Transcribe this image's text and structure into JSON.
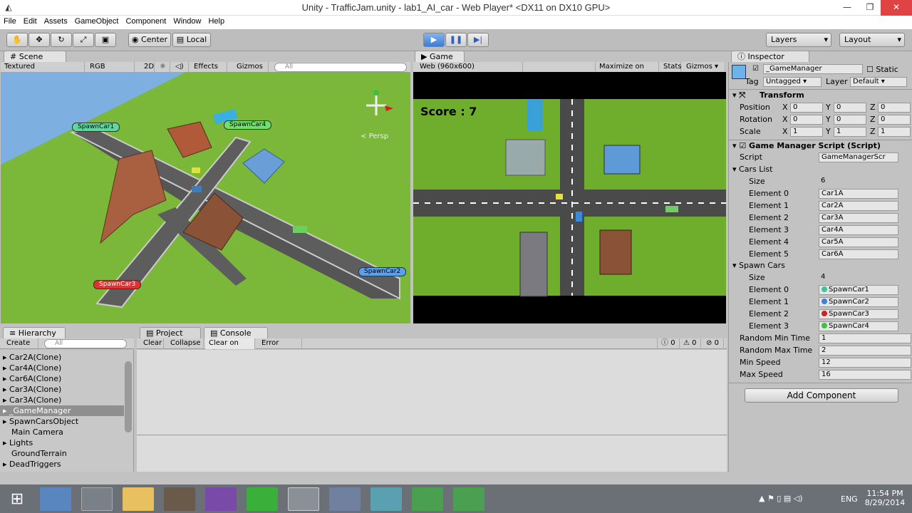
{
  "window": {
    "title": "Unity - TrafficJam.unity - lab1_AI_car - Web Player* <DX11 on DX10 GPU>"
  },
  "menu": [
    "File",
    "Edit",
    "Assets",
    "GameObject",
    "Component",
    "Window",
    "Help"
  ],
  "toolbar": {
    "center": "Center",
    "local": "Local",
    "layers": "Layers",
    "layout": "Layout"
  },
  "scene": {
    "tab": "Scene",
    "textured": "Textured",
    "rgb": "RGB",
    "mode2d": "2D",
    "effects": "Effects",
    "gizmos": "Gizmos",
    "search": "All",
    "persp": "Persp",
    "spawns": [
      {
        "label": "SpawnCar1",
        "color": "#5fd8a0"
      },
      {
        "label": "SpawnCar4",
        "color": "#6fe06a"
      },
      {
        "label": "SpawnCar2",
        "color": "#5aa0f0"
      },
      {
        "label": "SpawnCar3",
        "color": "#e33030"
      }
    ]
  },
  "game": {
    "tab": "Game",
    "resolution": "Web (960x600)",
    "maximize": "Maximize on Play",
    "stats": "Stats",
    "gizmos": "Gizmos",
    "score": "Score : 7"
  },
  "hierarchy": {
    "tab": "Hierarchy",
    "create": "Create",
    "search": "All",
    "items": [
      "Car2A(Clone)",
      "Car4A(Clone)",
      "Car6A(Clone)",
      "Car3A(Clone)",
      "Car3A(Clone)",
      "_GameManager",
      "SpawnCarsObject",
      "Main Camera",
      "Lights",
      "GroundTerrain",
      "DeadTriggers"
    ]
  },
  "console": {
    "project_tab": "Project",
    "tab": "Console",
    "clear": "Clear",
    "collapse": "Collapse",
    "clear_on_play": "Clear on Play",
    "error_pause": "Error Pause",
    "info_count": "0",
    "warn_count": "0",
    "err_count": "0"
  },
  "inspector": {
    "tab": "Inspector",
    "object_name": "_GameManager",
    "static": "Static",
    "tag_label": "Tag",
    "tag": "Untagged",
    "layer_label": "Layer",
    "layer": "Default",
    "transform": "Transform",
    "position": "Position",
    "rotation": "Rotation",
    "scale": "Scale",
    "pos": [
      "0",
      "0",
      "0"
    ],
    "rot": [
      "0",
      "0",
      "0"
    ],
    "scl": [
      "1",
      "1",
      "1"
    ],
    "script_component": "Game Manager Script (Script)",
    "script_label": "Script",
    "script_value": "GameManagerScr",
    "cars_list": "Cars List",
    "size": "Size",
    "cars_size": "6",
    "cars": [
      {
        "label": "Element 0",
        "value": "Car1A"
      },
      {
        "label": "Element 1",
        "value": "Car2A"
      },
      {
        "label": "Element 2",
        "value": "Car3A"
      },
      {
        "label": "Element 3",
        "value": "Car4A"
      },
      {
        "label": "Element 4",
        "value": "Car5A"
      },
      {
        "label": "Element 5",
        "value": "Car6A"
      }
    ],
    "spawn_cars": "Spawn Cars",
    "spawn_size": "4",
    "spawns": [
      {
        "label": "Element 0",
        "value": "SpawnCar1",
        "color": "#3fc39a"
      },
      {
        "label": "Element 1",
        "value": "SpawnCar2",
        "color": "#3f7fe0"
      },
      {
        "label": "Element 2",
        "value": "SpawnCar3",
        "color": "#d02020"
      },
      {
        "label": "Element 3",
        "value": "SpawnCar4",
        "color": "#3fc040"
      }
    ],
    "rmin_label": "Random Min Time",
    "rmin": "1",
    "rmax_label": "Random Max Time",
    "rmax": "2",
    "minspeed_label": "Min Speed",
    "minspeed": "12",
    "maxspeed_label": "Max Speed",
    "maxspeed": "16",
    "add_component": "Add Component"
  },
  "taskbar": {
    "lang": "ENG",
    "time": "11:54 PM",
    "date": "8/29/2014"
  }
}
